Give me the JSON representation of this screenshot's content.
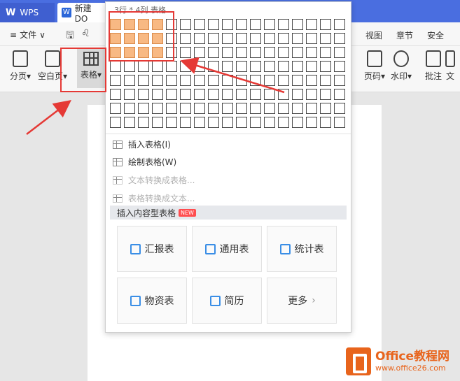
{
  "tabs": [
    {
      "label": "WPS"
    },
    {
      "label": "新建 DO"
    }
  ],
  "menu": {
    "file": "文件",
    "items": [
      {
        "label": "视图"
      },
      {
        "label": "章节"
      },
      {
        "label": "安全"
      }
    ]
  },
  "ribbon": {
    "page_break": "分页",
    "blank_page": "空白页",
    "table": "表格",
    "page_number": "页码",
    "watermark": "水印",
    "comment": "批注",
    "more": "文"
  },
  "table_panel": {
    "size_label": "3行 * 4列 表格",
    "rows": 8,
    "cols": 17,
    "selected_rows": 3,
    "selected_cols": 4,
    "insert_table": "插入表格(I)",
    "draw_table": "绘制表格(W)",
    "text_to_table": "文本转换成表格...",
    "table_to_text": "表格转换成文本...",
    "content_tables_header": "插入内容型表格",
    "new_badge": "NEW",
    "cards": [
      {
        "label": "汇报表"
      },
      {
        "label": "通用表"
      },
      {
        "label": "统计表"
      },
      {
        "label": "物资表"
      },
      {
        "label": "简历"
      },
      {
        "label": "更多"
      }
    ]
  },
  "watermark_brand": {
    "title": "Office教程网",
    "url": "www.office26.com"
  },
  "colors": {
    "title_bar": "#4a6ee0",
    "selected_cell": "#f8b983",
    "annotation": "#e53935",
    "brand": "#e8641c"
  }
}
